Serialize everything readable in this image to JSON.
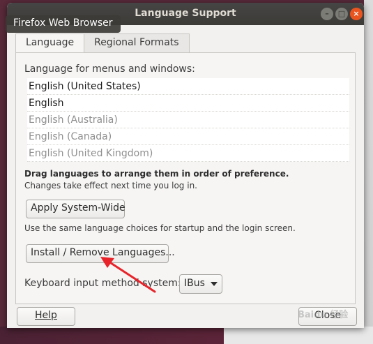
{
  "window": {
    "title": "Language Support",
    "controls": {
      "minimize": "–",
      "maximize": "□",
      "close": "×"
    }
  },
  "tooltip": "Firefox Web Browser",
  "tabs": [
    {
      "label": "Language",
      "active": true
    },
    {
      "label": "Regional Formats",
      "active": false
    }
  ],
  "language_panel": {
    "list_label": "Language for menus and windows:",
    "languages": [
      {
        "name": "English (United States)",
        "enabled": true
      },
      {
        "name": "English",
        "enabled": true
      },
      {
        "name": "English (Australia)",
        "enabled": false
      },
      {
        "name": "English (Canada)",
        "enabled": false
      },
      {
        "name": "English (United Kingdom)",
        "enabled": false
      }
    ],
    "drag_hint": "Drag languages to arrange them in order of preference.",
    "effect_hint": "Changes take effect next time you log in.",
    "apply_button": "Apply System-Wide",
    "apply_note": "Use the same language choices for startup and the login screen.",
    "install_button": "Install / Remove Languages...",
    "keyboard_label": "Keyboard input method system:",
    "keyboard_value": "IBus"
  },
  "footer": {
    "help_button": "Help",
    "close_button": "Close"
  },
  "annotation": {
    "arrow_color": "#e8232a"
  },
  "watermark": "Baidu 经验"
}
